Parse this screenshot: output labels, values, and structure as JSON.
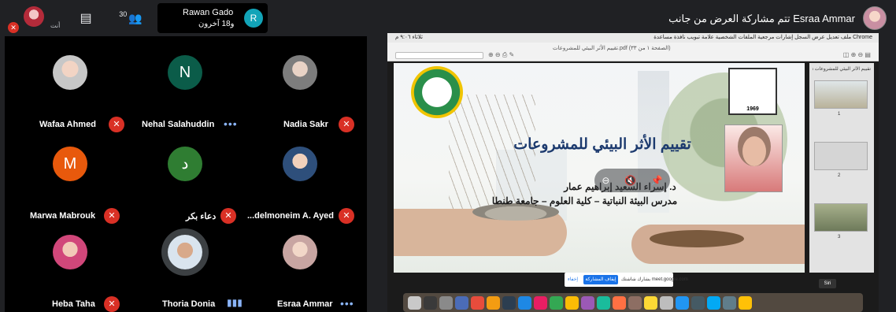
{
  "topbar": {
    "self_label": "أنت",
    "people_count": "30",
    "presenter": {
      "name": "Rawan Gado",
      "others": "و18 آخرون",
      "initial": "R",
      "avatar_color": "#12a4b8"
    },
    "share_banner": "تتم مشاركة العرض من جانب Esraa Ammar"
  },
  "participants": [
    {
      "name": "Wafaa Ahmed",
      "status": "muted",
      "avatar": "photo"
    },
    {
      "name": "Nehal Salahuddin",
      "status": "dots",
      "avatar": "initial",
      "initial": "N",
      "color": "#0b5c49"
    },
    {
      "name": "Nadia Sakr",
      "status": "muted",
      "avatar": "photo"
    },
    {
      "name": "Marwa Mabrouk",
      "status": "muted",
      "avatar": "initial",
      "initial": "M",
      "color": "#e8590c"
    },
    {
      "name": "دعاء بكر",
      "status": "muted",
      "avatar": "initial",
      "initial": "د",
      "color": "#2f7d32"
    },
    {
      "name": "...delmoneim A. Ayed",
      "status": "muted",
      "avatar": "photo"
    },
    {
      "name": "Heba Taha",
      "status": "muted",
      "avatar": "photo"
    },
    {
      "name": "Thoria Donia",
      "status": "speaking",
      "avatar": "photo"
    },
    {
      "name": "Esraa Ammar",
      "status": "dots",
      "avatar": "photo"
    }
  ],
  "screen": {
    "menubar_left": "Chrome  ملف  تعديل  عرض  السجل  إشارات مرجعية  الملفات الشخصية  علامة تبويب  نافذة  مساعدة",
    "menubar_right": "ثلاثاء ٩:٠٦ م",
    "pdf_title": "تقييم الأثر البيئي للمشروعات.pdf (الصفحة ١ من ٣٣)",
    "slide": {
      "logo_year": "1969",
      "title": "تقييم الأثر البيئي للمشروعات",
      "author": "د. إسراء السعيد إبراهيم عمار",
      "position": "مدرس البيئة النباتية – كلية العلوم – جامعة طنطا"
    },
    "thumbnails": {
      "title": "تقييم الأثر البيئي للمشروعات تنهار...",
      "pages": [
        "1",
        "2",
        "3"
      ]
    },
    "meet_bar": {
      "text": "meet.google.com يشارك شاشتك",
      "stop": "إيقاف المشاركة",
      "hide": "إخفاء"
    },
    "tooltip": "Siri",
    "dock_colors": [
      "#c9c9c9",
      "#3a3a3a",
      "#8a8a8a",
      "#4b6cb7",
      "#e74c3c",
      "#f39c12",
      "#2c3e50",
      "#1e88e5",
      "#e91e63",
      "#34a853",
      "#fbbc05",
      "#9b59b6",
      "#1abc9c",
      "#ff7043",
      "#8d6e63",
      "#fdd835",
      "#bdbdbd",
      "#2196f3",
      "#455a64",
      "#03a9f4",
      "#607d8b",
      "#ffc107"
    ]
  }
}
